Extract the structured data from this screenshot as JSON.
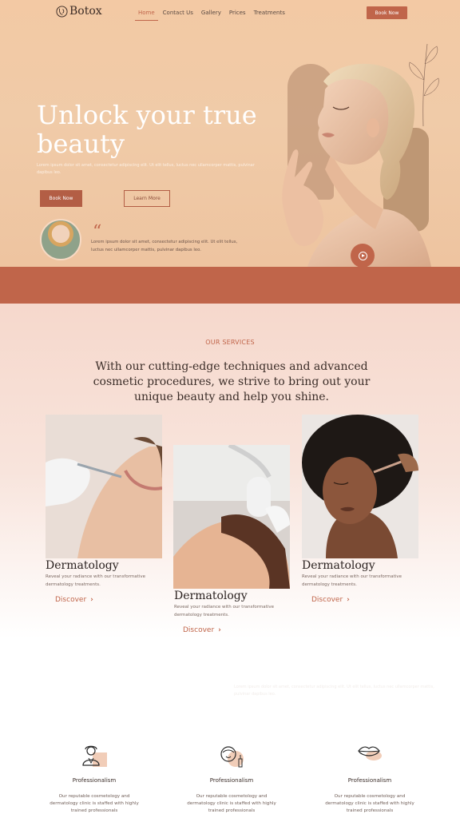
{
  "header": {
    "logo_text": "Botox",
    "nav": [
      {
        "label": "Home",
        "active": true
      },
      {
        "label": "Contact Us",
        "active": false
      },
      {
        "label": "Gallery",
        "active": false
      },
      {
        "label": "Prices",
        "active": false
      },
      {
        "label": "Treatments",
        "active": false
      }
    ],
    "book_label": "Book Now"
  },
  "hero": {
    "title": "Unlock your true beauty",
    "subtitle": "Lorem ipsum dolor sit amet, consectetur adipiscing elit. Ut elit tellus, luctus nec ullamcorper mattis, pulvinar dapibus leo.",
    "book_label": "Book Now",
    "learn_label": "Learn More",
    "quote_mark": "“",
    "testimonial": "Lorem ipsum dolor sit amet, consectetur adipiscing elit. Ut elit tellus, luctus nec ullamcorper mattis, pulvinar dapibus leo."
  },
  "services": {
    "label": "OUR SERVICES",
    "heading": "With our cutting-edge techniques and advanced cosmetic procedures, we strive to bring out your unique beauty and help you shine.",
    "cards": [
      {
        "title": "Dermatology",
        "desc": "Reveal your radiance with our transformative dermatology treatments.",
        "link": "Discover"
      },
      {
        "title": "Dermatology",
        "desc": "Reveal your radiance with our transformative dermatology treatments.",
        "link": "Discover"
      },
      {
        "title": "Dermatology",
        "desc": "Reveal your radiance with our transformative dermatology treatments.",
        "link": "Discover"
      }
    ]
  },
  "faint_text": "Lorem ipsum dolor sit amet, consectetur adipiscing elit. Ut elit tellus, luctus nec ullamcorper mattis, pulvinar dapibus leo.",
  "features": [
    {
      "icon": "doctor-icon",
      "title": "Professionalism",
      "desc": "Our reputable cosmetology and dermatology clinic is staffed with highly trained professionals"
    },
    {
      "icon": "face-serum-icon",
      "title": "Professionalism",
      "desc": "Our reputable cosmetology and dermatology clinic is staffed with highly trained professionals"
    },
    {
      "icon": "lips-icon",
      "title": "Professionalism",
      "desc": "Our reputable cosmetology and dermatology clinic is staffed with highly trained professionals"
    }
  ],
  "colors": {
    "accent": "#c0654a",
    "hero_bg": "#f0cba8",
    "band": "#c0654a"
  }
}
